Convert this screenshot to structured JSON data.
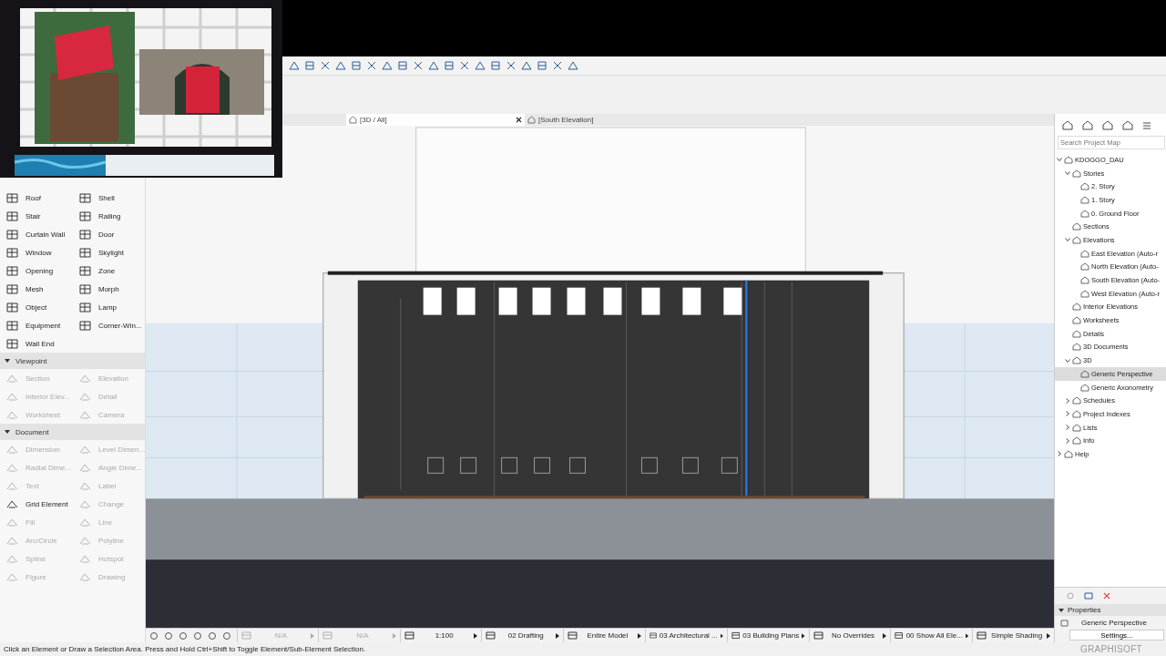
{
  "tabs": [
    {
      "label": "[3D / All]",
      "selected": true
    },
    {
      "label": "[South Elevation]",
      "selected": false
    }
  ],
  "toolbox": {
    "design_tools": [
      {
        "label": "Roof",
        "disabled": false
      },
      {
        "label": "Shell",
        "disabled": false
      },
      {
        "label": "Stair",
        "disabled": false
      },
      {
        "label": "Railing",
        "disabled": false
      },
      {
        "label": "Curtain Wall",
        "disabled": false
      },
      {
        "label": "Door",
        "disabled": false
      },
      {
        "label": "Window",
        "disabled": false
      },
      {
        "label": "Skylight",
        "disabled": false
      },
      {
        "label": "Opening",
        "disabled": false
      },
      {
        "label": "Zone",
        "disabled": false
      },
      {
        "label": "Mesh",
        "disabled": false
      },
      {
        "label": "Morph",
        "disabled": false
      },
      {
        "label": "Object",
        "disabled": false
      },
      {
        "label": "Lamp",
        "disabled": false
      },
      {
        "label": "Equipment",
        "disabled": false
      },
      {
        "label": "Corner-Win...",
        "disabled": false
      },
      {
        "label": "Wall End",
        "disabled": false
      }
    ],
    "sections": [
      {
        "title": "Viewpoint",
        "expanded": true,
        "items": [
          {
            "label": "Section",
            "disabled": true
          },
          {
            "label": "Elevation",
            "disabled": true
          },
          {
            "label": "Interior Elev...",
            "disabled": true
          },
          {
            "label": "Detail",
            "disabled": true
          },
          {
            "label": "Worksheet",
            "disabled": true
          },
          {
            "label": "Camera",
            "disabled": true
          }
        ]
      },
      {
        "title": "Document",
        "expanded": true,
        "items": [
          {
            "label": "Dimension",
            "disabled": true
          },
          {
            "label": "Level Dimen...",
            "disabled": true
          },
          {
            "label": "Radial Dime...",
            "disabled": true
          },
          {
            "label": "Angle Dime...",
            "disabled": true
          },
          {
            "label": "Text",
            "disabled": true
          },
          {
            "label": "Label",
            "disabled": true
          },
          {
            "label": "Grid Element",
            "disabled": false
          },
          {
            "label": "Change",
            "disabled": true
          },
          {
            "label": "Fill",
            "disabled": true
          },
          {
            "label": "Line",
            "disabled": true
          },
          {
            "label": "Arc/Circle",
            "disabled": true
          },
          {
            "label": "Polyline",
            "disabled": true
          },
          {
            "label": "Spline",
            "disabled": true
          },
          {
            "label": "Hotspot",
            "disabled": true
          },
          {
            "label": "Figure",
            "disabled": true
          },
          {
            "label": "Drawing",
            "disabled": true
          }
        ]
      }
    ]
  },
  "navigator": {
    "search": {
      "placeholder": "Search Project Map"
    },
    "tree": [
      {
        "label": "KDOGGO_DAU",
        "expanded": true,
        "selected": false,
        "children": [
          {
            "label": "Stories",
            "expanded": true,
            "selected": false,
            "children": [
              {
                "label": "2. Story",
                "selected": false
              },
              {
                "label": "1. Story",
                "selected": false
              },
              {
                "label": "0. Ground Floor",
                "selected": false
              }
            ]
          },
          {
            "label": "Sections",
            "selected": false
          },
          {
            "label": "Elevations",
            "expanded": true,
            "selected": false,
            "children": [
              {
                "label": "East Elevation (Auto-r",
                "selected": false
              },
              {
                "label": "North Elevation (Auto-",
                "selected": false
              },
              {
                "label": "South Elevation (Auto-",
                "selected": false
              },
              {
                "label": "West Elevation (Auto-r",
                "selected": false
              }
            ]
          },
          {
            "label": "Interior Elevations",
            "selected": false
          },
          {
            "label": "Worksheets",
            "selected": false
          },
          {
            "label": "Details",
            "selected": false
          },
          {
            "label": "3D Documents",
            "selected": false
          },
          {
            "label": "3D",
            "expanded": true,
            "selected": false,
            "children": [
              {
                "label": "Generic Perspective",
                "selected": true
              },
              {
                "label": "Generic Axonometry",
                "selected": false
              }
            ]
          },
          {
            "label": "Schedules",
            "expanded": false,
            "selected": false
          },
          {
            "label": "Project Indexes",
            "expanded": false,
            "selected": false
          },
          {
            "label": "Lists",
            "expanded": false,
            "selected": false
          },
          {
            "label": "Info",
            "expanded": false,
            "selected": false
          }
        ]
      },
      {
        "label": "Help",
        "expanded": false,
        "selected": false
      }
    ]
  },
  "properties": {
    "title": "Properties",
    "expanded": true,
    "view": "Generic Perspective",
    "button": "Settings..."
  },
  "view_bar": [
    {
      "label": "N/A",
      "disabled": true
    },
    {
      "label": "N/A",
      "disabled": true
    },
    {
      "label": "1:100",
      "disabled": false
    },
    {
      "label": "02 Drafting",
      "disabled": false
    },
    {
      "label": "Entire Model",
      "disabled": false
    },
    {
      "label": "03 Architectural ...",
      "disabled": false
    },
    {
      "label": "03 Building Plans",
      "disabled": false
    },
    {
      "label": "No Overrides",
      "disabled": false
    },
    {
      "label": "00 Show All Ele...",
      "disabled": false
    },
    {
      "label": "Simple Shading",
      "disabled": false
    }
  ],
  "status_bar": {
    "message": "Click an Element or Draw a Selection Area. Press and Hold Ctrl+Shift to Toggle Element/Sub-Element Selection.",
    "logo": "GRAPHISOFT"
  }
}
